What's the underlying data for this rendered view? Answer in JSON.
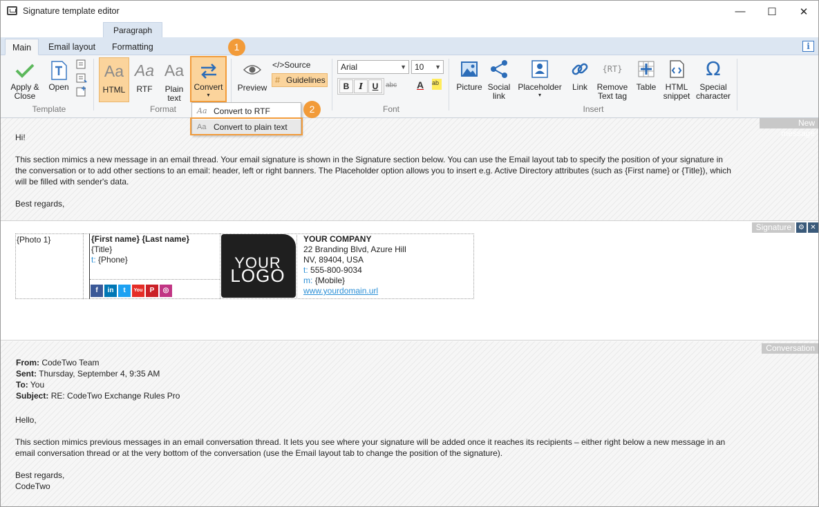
{
  "window": {
    "title": "Signature template editor",
    "minimize": "—",
    "maximize": "☐",
    "close": "✕"
  },
  "context_tab": "Paragraph",
  "tabs": [
    {
      "label": "Main"
    },
    {
      "label": "Email layout"
    },
    {
      "label": "Formatting"
    }
  ],
  "info_button": "i",
  "ribbon": {
    "template": {
      "group_label": "Template",
      "apply_close": "Apply &",
      "apply_close2": "Close",
      "open": "Open"
    },
    "format": {
      "group_label": "Format",
      "html": "HTML",
      "rtf": "RTF",
      "plain": "Plain",
      "plain2": "text",
      "convert": "Convert",
      "aa": "Aa"
    },
    "preview": "Preview",
    "source": "</>Source",
    "guidelines": "Guidelines",
    "font": {
      "group_label": "Font",
      "family": "Arial",
      "size": "10",
      "bold": "B",
      "italic": "I",
      "underline": "U",
      "strike": "abc",
      "color": "A",
      "highlight": "ab"
    },
    "insert": {
      "group_label": "Insert",
      "picture": "Picture",
      "social": "Social",
      "social2": "link",
      "placeholder": "Placeholder",
      "link": "Link",
      "remove_text": "Remove",
      "remove_text2": "Text tag",
      "table": "Table",
      "html_snippet": "HTML",
      "html_snippet2": "snippet",
      "special": "Special",
      "special2": "character",
      "rt": "RT"
    }
  },
  "convert_menu": {
    "items": [
      {
        "icon": "Aa",
        "label": "Convert to RTF"
      },
      {
        "icon": "Aa",
        "label": "Convert to plain text"
      }
    ]
  },
  "callouts": [
    "1",
    "2"
  ],
  "new_message": {
    "tag": "New message",
    "greeting": "Hi!",
    "line1": "This section mimics a new message in an email thread. Your email signature is shown in the Signature section below. You can use the Email layout tab to specify the position of your signature in",
    "line2": "the conversation or to add other sections to an email: header, left or right banners. The Placeholder option allows you to insert e.g. Active Directory attributes (such as {First name} or {Title}), which",
    "line3": "will be filled with sender's data.",
    "closing": "Best regards,"
  },
  "signature": {
    "tag": "Signature",
    "settings_icon": "⚙",
    "close_icon": "✕",
    "photo": "{Photo 1}",
    "name": "{First name} {Last name}",
    "title": "{Title}",
    "phone_prefix": "t:",
    "phone": "{Phone}",
    "logo_line1": "YOUR",
    "logo_line2": "LOGO",
    "company": "YOUR COMPANY",
    "address1": "22 Branding Blvd, Azure Hill",
    "address2": "NV, 89404, USA",
    "tel_prefix": "t:",
    "tel": "555-800-9034",
    "mob_prefix": "m:",
    "mobile": "{Mobile}",
    "url": "www.yourdomain.url",
    "social": [
      {
        "name": "facebook",
        "glyph": "f",
        "color": "#3b5998"
      },
      {
        "name": "linkedin",
        "glyph": "in",
        "color": "#0077b5"
      },
      {
        "name": "twitter",
        "glyph": "t",
        "color": "#1da1f2"
      },
      {
        "name": "youtube",
        "glyph": "You",
        "color": "#e52d27"
      },
      {
        "name": "pinterest",
        "glyph": "P",
        "color": "#cb2027"
      },
      {
        "name": "instagram",
        "glyph": "◎",
        "color": "#c13584"
      }
    ]
  },
  "conversation": {
    "tag": "Conversation",
    "from_label": "From:",
    "from": "CodeTwo Team",
    "sent_label": "Sent:",
    "sent": "Thursday, September 4, 9:35 AM",
    "to_label": "To:",
    "to": "You",
    "subject_label": "Subject:",
    "subject": "RE: CodeTwo Exchange Rules Pro",
    "greeting": "Hello,",
    "line1": "This section mimics previous messages in an email conversation thread. It lets you see where your signature will be added once it reaches its recipients – either right below a new message in an",
    "line2": "email conversation thread or at the very bottom of the conversation (use the Email layout tab to change the position of the signature).",
    "closing1": "Best regards,",
    "closing2": "CodeTwo"
  }
}
